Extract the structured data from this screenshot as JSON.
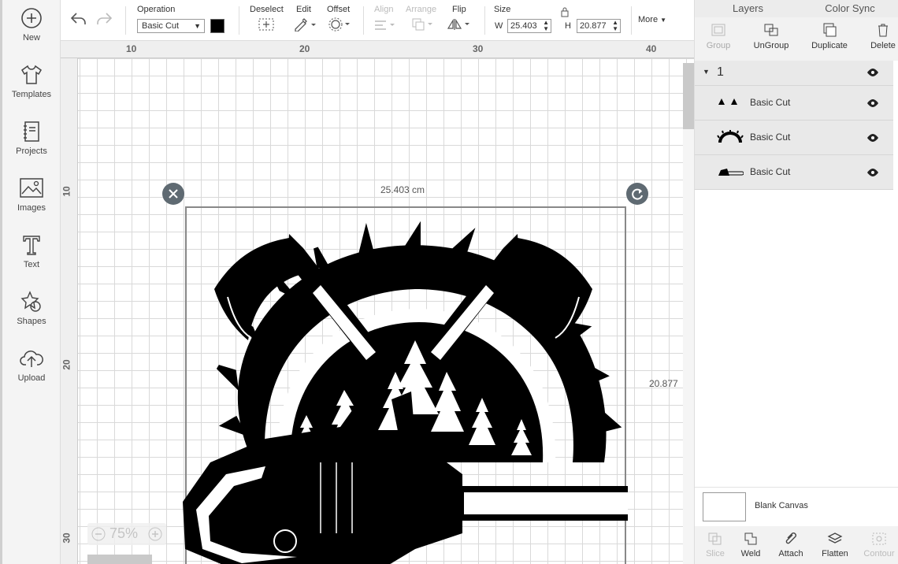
{
  "left_nav": [
    {
      "label": "New",
      "icon": "plus-circle-icon"
    },
    {
      "label": "Templates",
      "icon": "tshirt-icon"
    },
    {
      "label": "Projects",
      "icon": "notebook-icon"
    },
    {
      "label": "Images",
      "icon": "image-icon"
    },
    {
      "label": "Text",
      "icon": "text-t-icon"
    },
    {
      "label": "Shapes",
      "icon": "shapes-icon"
    },
    {
      "label": "Upload",
      "icon": "cloud-upload-icon"
    }
  ],
  "toolbar": {
    "operation_label": "Operation",
    "operation_value": "Basic Cut",
    "color_swatch": "#000000",
    "deselect": "Deselect",
    "edit": "Edit",
    "offset": "Offset",
    "align": "Align",
    "arrange": "Arrange",
    "flip": "Flip",
    "size": "Size",
    "w_label": "W",
    "w_value": "25.403",
    "h_label": "H",
    "h_value": "20.877",
    "more": "More"
  },
  "canvas": {
    "ruler_top": [
      "10",
      "20",
      "30",
      "40"
    ],
    "ruler_left": [
      "10",
      "20",
      "30"
    ],
    "width_dim": "25.403 cm",
    "height_dim": "20.877",
    "zoom": "75%"
  },
  "right_panel": {
    "tabs": [
      "Layers",
      "Color Sync"
    ],
    "actions": [
      {
        "label": "Group",
        "enabled": false
      },
      {
        "label": "UnGroup",
        "enabled": true
      },
      {
        "label": "Duplicate",
        "enabled": true
      },
      {
        "label": "Delete",
        "enabled": true
      }
    ],
    "group_name": "1",
    "layers": [
      {
        "name": "Basic Cut",
        "thumb": "axes-thumb"
      },
      {
        "name": "Basic Cut",
        "thumb": "saw-blade-thumb"
      },
      {
        "name": "Basic Cut",
        "thumb": "chainsaw-thumb"
      }
    ],
    "blank_canvas": "Blank Canvas",
    "bottom_actions": [
      {
        "label": "Slice",
        "enabled": false
      },
      {
        "label": "Weld",
        "enabled": true
      },
      {
        "label": "Attach",
        "enabled": true
      },
      {
        "label": "Flatten",
        "enabled": true
      },
      {
        "label": "Contour",
        "enabled": false
      }
    ]
  },
  "colors": {
    "accent": "#333333",
    "panel_bg": "#e9e9e9",
    "grid": "#d9d9d9"
  }
}
